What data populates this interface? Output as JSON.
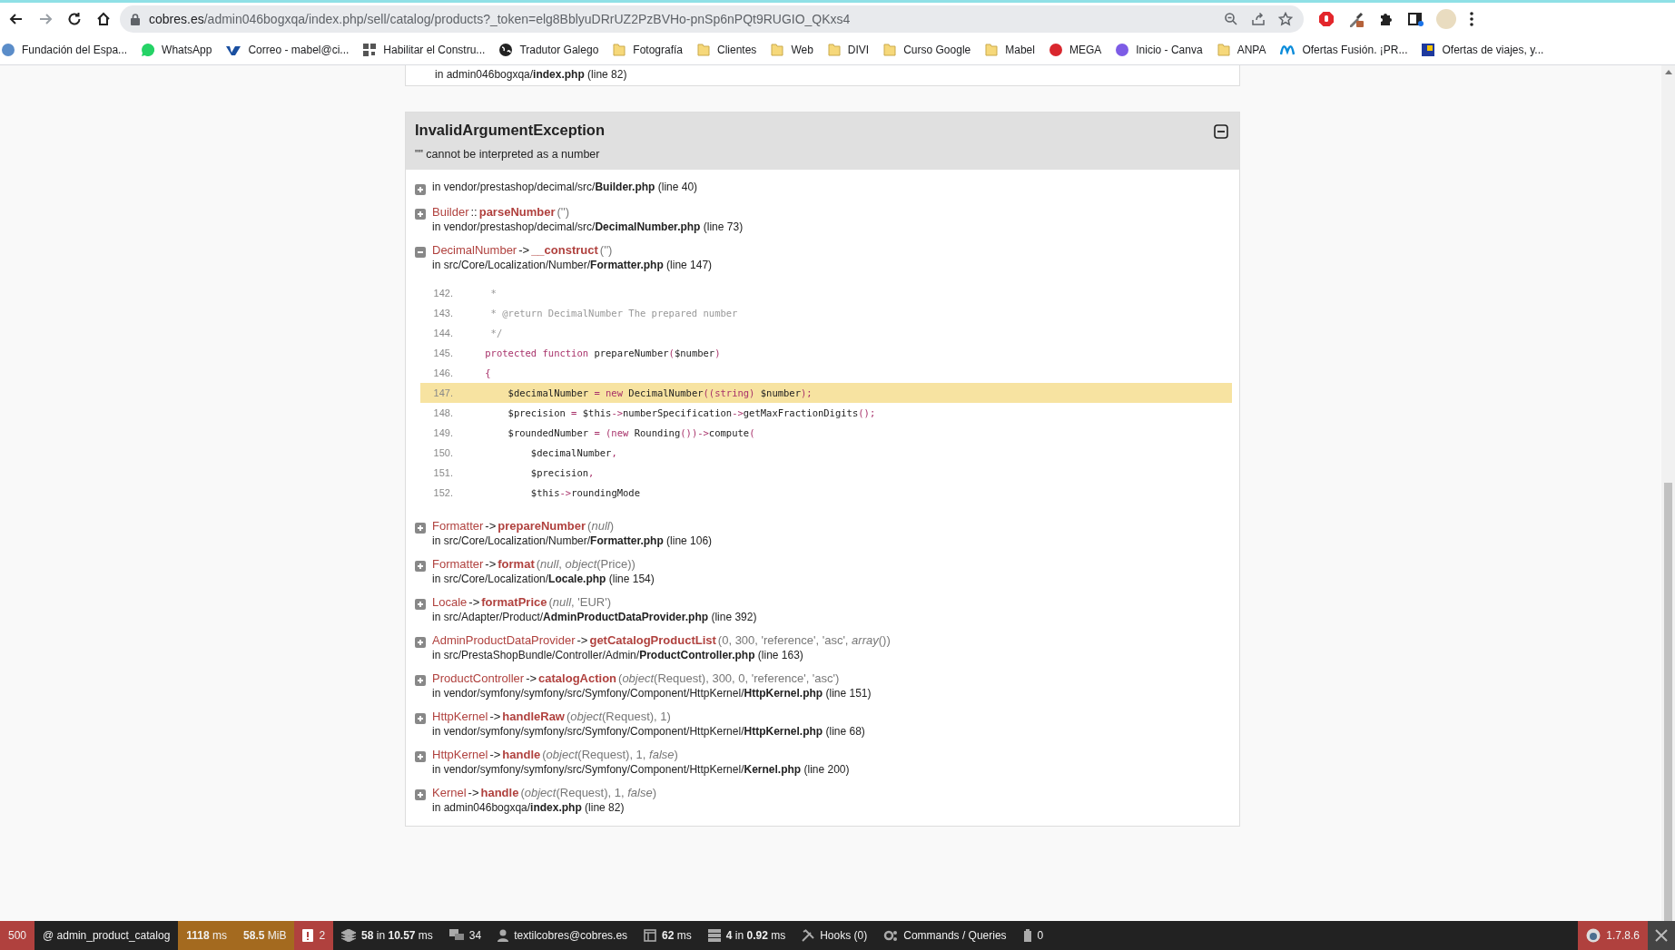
{
  "browser": {
    "nav": [
      {
        "kind": "back",
        "disabled": false
      },
      {
        "kind": "forward",
        "disabled": true
      },
      {
        "kind": "reload",
        "disabled": false
      },
      {
        "kind": "home",
        "disabled": false
      }
    ],
    "address": {
      "domain": "cobres.es",
      "path": "/admin046bogxqa/index.php/sell/catalog/products?_token=elg8BblyuDRrUZ2PzBVHo-pnSp6nPQt9RUGIO_QKxs4"
    },
    "bookmarks": [
      {
        "label": "Fundación del Espa...",
        "kind": "letter",
        "color": "#5b8dc9"
      },
      {
        "label": "WhatsApp",
        "kind": "chat",
        "color": "#25d366"
      },
      {
        "label": "Correo - mabel@ci...",
        "kind": "mail",
        "color": "#1a4fa0"
      },
      {
        "label": "Habilitar el Constru...",
        "kind": "grid",
        "color": "#555555"
      },
      {
        "label": "Tradutor Galego",
        "kind": "globe",
        "color": "#222222"
      },
      {
        "label": "Fotografía",
        "kind": "folder",
        "color": "#f6d87a"
      },
      {
        "label": "Clientes",
        "kind": "folder",
        "color": "#f6d87a"
      },
      {
        "label": "Web",
        "kind": "folder",
        "color": "#f6d87a"
      },
      {
        "label": "DIVI",
        "kind": "folder",
        "color": "#f6d87a"
      },
      {
        "label": "Curso Google",
        "kind": "folder",
        "color": "#f6d87a"
      },
      {
        "label": "Mabel",
        "kind": "folder",
        "color": "#f6d87a"
      },
      {
        "label": "MEGA",
        "kind": "letter",
        "color": "#d9272e"
      },
      {
        "label": "Inicio - Canva",
        "kind": "letter",
        "color": "#7d5ce6"
      },
      {
        "label": "ANPA",
        "kind": "folder",
        "color": "#f6d87a"
      },
      {
        "label": "Ofertas Fusión. ¡PR...",
        "kind": "wave",
        "color": "#0b8cda"
      },
      {
        "label": "Ofertas de viajes, y...",
        "kind": "square",
        "color": "#1e3a9e"
      }
    ]
  },
  "previous_frame": {
    "location": "in admin046bogxqa/**index.php** (line 82)"
  },
  "exception": {
    "title": "InvalidArgumentException",
    "message": "\"\" cannot be interpreted as a number",
    "expanded": true,
    "frames": [
      {
        "expanded": false,
        "location": "in vendor/prestashop/decimal/src/**Builder.php** (line 40)"
      },
      {
        "expanded": false,
        "class": "Builder",
        "call": "::",
        "function": "parseNumber",
        "args": "('')",
        "location": "in vendor/prestashop/decimal/src/**DecimalNumber.php** (line 73)"
      },
      {
        "expanded": true,
        "class": "DecimalNumber",
        "call": "->",
        "function": "__construct",
        "args": "('')",
        "location": "in src/Core/Localization/Number/**Formatter.php** (line 147)",
        "code": [
          {
            "number": "142.",
            "current": false,
            "tokens": [
              {
                "kind": "comment",
                "text": "     *"
              }
            ]
          },
          {
            "number": "143.",
            "current": false,
            "tokens": [
              {
                "kind": "comment",
                "text": "     * @return DecimalNumber The prepared number"
              }
            ]
          },
          {
            "number": "144.",
            "current": false,
            "tokens": [
              {
                "kind": "comment",
                "text": "     */"
              }
            ]
          },
          {
            "number": "145.",
            "current": false,
            "tokens": [
              {
                "kind": "keyword",
                "text": "    protected function "
              },
              {
                "kind": "plain",
                "text": "prepareNumber"
              },
              {
                "kind": "keyword",
                "text": "("
              },
              {
                "kind": "plain",
                "text": "$number"
              },
              {
                "kind": "keyword",
                "text": ")"
              }
            ]
          },
          {
            "number": "146.",
            "current": false,
            "tokens": [
              {
                "kind": "keyword",
                "text": "    {"
              }
            ]
          },
          {
            "number": "147.",
            "current": true,
            "tokens": [
              {
                "kind": "plain",
                "text": "        $decimalNumber "
              },
              {
                "kind": "keyword",
                "text": "= new "
              },
              {
                "kind": "plain",
                "text": "DecimalNumber"
              },
              {
                "kind": "keyword",
                "text": "((string) "
              },
              {
                "kind": "plain",
                "text": "$number"
              },
              {
                "kind": "keyword",
                "text": ");"
              }
            ]
          },
          {
            "number": "148.",
            "current": false,
            "tokens": [
              {
                "kind": "plain",
                "text": "        $precision "
              },
              {
                "kind": "keyword",
                "text": "= "
              },
              {
                "kind": "plain",
                "text": "$this"
              },
              {
                "kind": "keyword",
                "text": "->"
              },
              {
                "kind": "plain",
                "text": "numberSpecification"
              },
              {
                "kind": "keyword",
                "text": "->"
              },
              {
                "kind": "plain",
                "text": "getMaxFractionDigits"
              },
              {
                "kind": "keyword",
                "text": "();"
              }
            ]
          },
          {
            "number": "149.",
            "current": false,
            "tokens": [
              {
                "kind": "plain",
                "text": "        $roundedNumber "
              },
              {
                "kind": "keyword",
                "text": "= (new "
              },
              {
                "kind": "plain",
                "text": "Rounding"
              },
              {
                "kind": "keyword",
                "text": "())->"
              },
              {
                "kind": "plain",
                "text": "compute"
              },
              {
                "kind": "keyword",
                "text": "("
              }
            ]
          },
          {
            "number": "150.",
            "current": false,
            "tokens": [
              {
                "kind": "plain",
                "text": "            $decimalNumber"
              },
              {
                "kind": "keyword",
                "text": ","
              }
            ]
          },
          {
            "number": "151.",
            "current": false,
            "tokens": [
              {
                "kind": "plain",
                "text": "            $precision"
              },
              {
                "kind": "keyword",
                "text": ","
              }
            ]
          },
          {
            "number": "152.",
            "current": false,
            "tokens": [
              {
                "kind": "plain",
                "text": "            $this"
              },
              {
                "kind": "keyword",
                "text": "->"
              },
              {
                "kind": "plain",
                "text": "roundingMode"
              }
            ]
          }
        ]
      },
      {
        "expanded": false,
        "class": "Formatter",
        "call": "->",
        "function": "prepareNumber",
        "args": "(*null*)",
        "location": "in src/Core/Localization/Number/**Formatter.php** (line 106)"
      },
      {
        "expanded": false,
        "class": "Formatter",
        "call": "->",
        "function": "format",
        "args": "(*null*, *object*(Price))",
        "location": "in src/Core/Localization/**Locale.php** (line 154)"
      },
      {
        "expanded": false,
        "class": "Locale",
        "call": "->",
        "function": "formatPrice",
        "args": "(*null*, 'EUR')",
        "location": "in src/Adapter/Product/**AdminProductDataProvider.php** (line 392)"
      },
      {
        "expanded": false,
        "class": "AdminProductDataProvider",
        "call": "->",
        "function": "getCatalogProductList",
        "args": "(0, 300, 'reference', 'asc', *array*())",
        "location": "in src/PrestaShopBundle/Controller/Admin/**ProductController.php** (line 163)"
      },
      {
        "expanded": false,
        "class": "ProductController",
        "call": "->",
        "function": "catalogAction",
        "args": "(*object*(Request), 300, 0, 'reference', 'asc')",
        "location": "in vendor/symfony/symfony/src/Symfony/Component/HttpKernel/**HttpKernel.php** (line 151)"
      },
      {
        "expanded": false,
        "class": "HttpKernel",
        "call": "->",
        "function": "handleRaw",
        "args": "(*object*(Request), 1)",
        "location": "in vendor/symfony/symfony/src/Symfony/Component/HttpKernel/**HttpKernel.php** (line 68)"
      },
      {
        "expanded": false,
        "class": "HttpKernel",
        "call": "->",
        "function": "handle",
        "args": "(*object*(Request), 1, *false*)",
        "location": "in vendor/symfony/symfony/src/Symfony/Component/HttpKernel/**Kernel.php** (line 200)"
      },
      {
        "expanded": false,
        "class": "Kernel",
        "call": "->",
        "function": "handle",
        "args": "(*object*(Request), 1, *false*)",
        "location": "in admin046bogxqa/**index.php** (line 82)"
      }
    ]
  },
  "debug_toolbar": {
    "items": [
      {
        "kind": "status",
        "text": "500",
        "color": "#b0413e"
      },
      {
        "kind": "route",
        "text": "@ admin_product_catalog"
      },
      {
        "kind": "time",
        "text": "**1118** ms",
        "color": "#a46a1f"
      },
      {
        "kind": "memory",
        "text": "**58.5** MiB",
        "color": "#a46a1f"
      },
      {
        "kind": "errors",
        "text": "2",
        "color": "#b0413e"
      },
      {
        "kind": "layers",
        "text": "**58** in **10.57** ms"
      },
      {
        "kind": "translations",
        "text": "34"
      },
      {
        "kind": "user",
        "text": "textilcobres@cobres.es"
      },
      {
        "kind": "render",
        "text": "**62** ms"
      },
      {
        "kind": "db",
        "text": "**4** in **0.92** ms"
      },
      {
        "kind": "hooks",
        "text": "Hooks (0)"
      },
      {
        "kind": "commands",
        "text": "Commands / Queries"
      },
      {
        "kind": "cache",
        "text": "0"
      }
    ],
    "version": {
      "text": "1.7.8.6",
      "color": "#b0413e"
    }
  }
}
